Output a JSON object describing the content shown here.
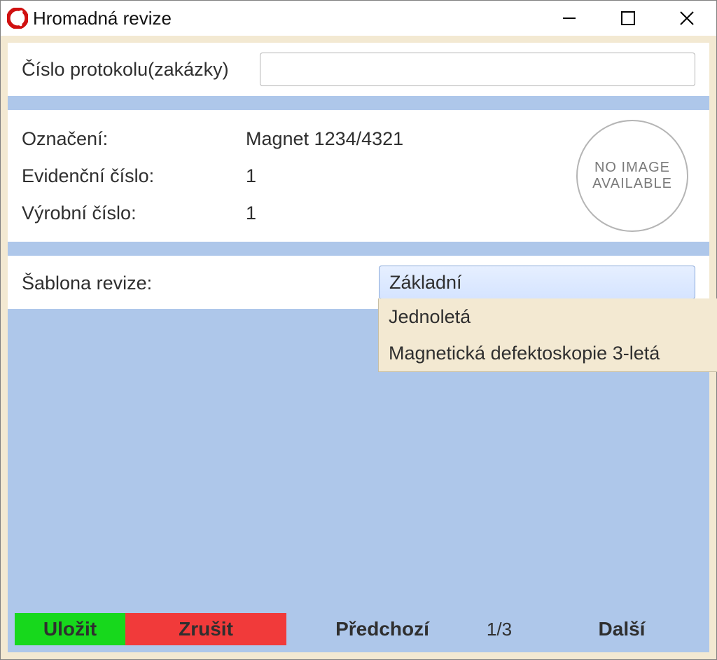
{
  "window": {
    "title": "Hromadná revize"
  },
  "protocol": {
    "label": "Číslo protokolu(zakázky)",
    "value": ""
  },
  "details": {
    "labels": {
      "designation": "Označení:",
      "registration_no": "Evidenční číslo:",
      "serial_no": "Výrobní číslo:"
    },
    "values": {
      "designation": "Magnet 1234/4321",
      "registration_no": "1",
      "serial_no": "1"
    },
    "image_placeholder": "NO IMAGE AVAILABLE"
  },
  "template": {
    "label": "Šablona revize:",
    "selected": "Základní",
    "options": [
      "Jednoletá",
      "Magnetická defektoskopie 3-letá"
    ]
  },
  "buttons": {
    "save": "Uložit",
    "cancel": "Zrušit",
    "prev": "Předchozí",
    "next": "Další"
  },
  "pager": "1/3"
}
